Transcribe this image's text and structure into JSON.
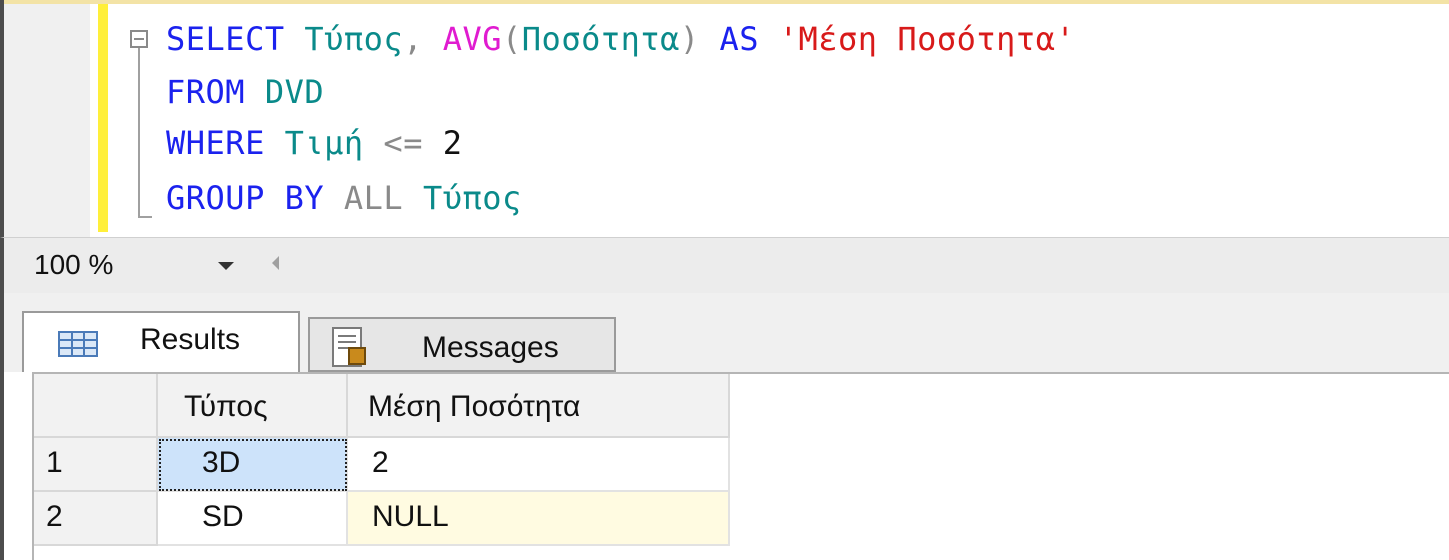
{
  "editor": {
    "line1": {
      "kw_select": "SELECT",
      "col_type": "Τύπος",
      "comma": ",",
      "fn_avg": "AVG",
      "paren_open": "(",
      "col_qty": "Ποσότητα",
      "paren_close": ")",
      "kw_as": "AS",
      "alias": "'Μέση Ποσότητα'"
    },
    "line2": {
      "kw_from": "FROM",
      "table": "DVD"
    },
    "line3": {
      "kw_where": "WHERE",
      "col_price": "Τιμή",
      "op": "<=",
      "value": "2"
    },
    "line4": {
      "kw_group": "GROUP",
      "kw_by": "BY",
      "kw_all": "ALL",
      "col_type": "Τύπος"
    }
  },
  "zoom": {
    "value": "100 %"
  },
  "tabs": {
    "results": "Results",
    "messages": "Messages"
  },
  "grid": {
    "columns": [
      "Τύπος",
      "Μέση Ποσότητα"
    ],
    "rows": [
      {
        "num": "1",
        "type": "3D",
        "avg": "2"
      },
      {
        "num": "2",
        "type": "SD",
        "avg": "NULL"
      }
    ]
  },
  "icons": {
    "fold": "collapse-minus-icon",
    "zoom_dropdown": "chevron-down-icon",
    "scroll_left": "arrow-left-icon",
    "results": "grid-icon",
    "messages": "messages-icon"
  },
  "colors": {
    "keyword": "#1b22ee",
    "function": "#e01bd0",
    "identifier": "#0a8a8a",
    "string": "#d81a1a",
    "selection": "#cde3fa",
    "null_cell": "#fffbe1"
  }
}
